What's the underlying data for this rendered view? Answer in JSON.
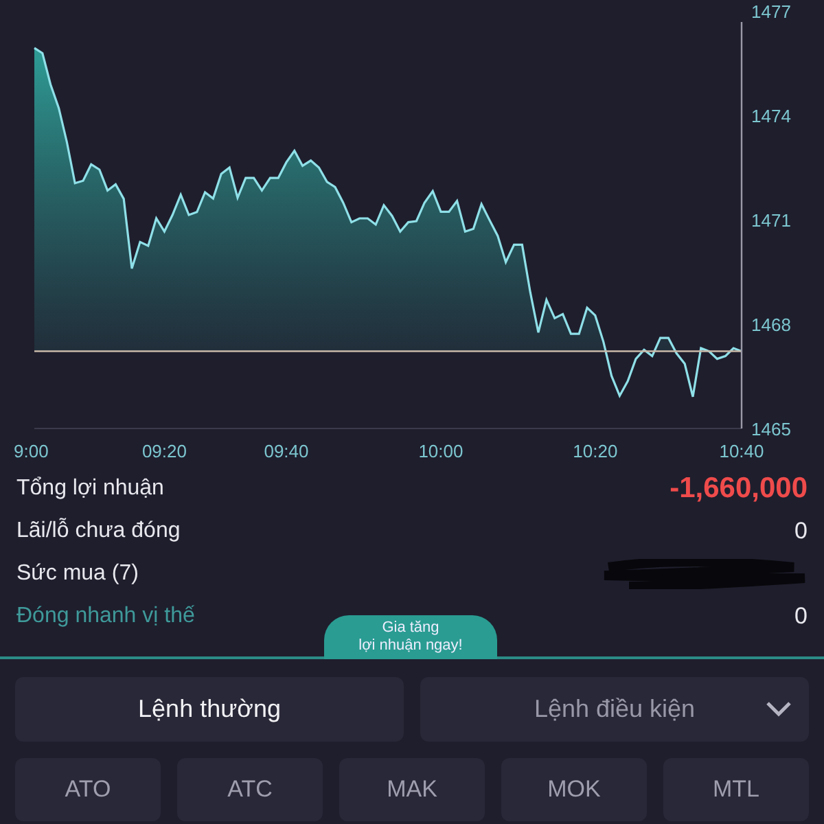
{
  "chart": {
    "chart_data": {
      "type": "area",
      "categories": [
        "9:00",
        null,
        null,
        null,
        null,
        null,
        null,
        null,
        null,
        null,
        null,
        null,
        null,
        null,
        null,
        null,
        "09:20",
        null,
        null,
        null,
        null,
        null,
        null,
        null,
        null,
        null,
        null,
        null,
        null,
        null,
        null,
        "09:40",
        null,
        null,
        null,
        null,
        null,
        null,
        null,
        null,
        null,
        null,
        null,
        null,
        null,
        null,
        null,
        null,
        null,
        null,
        "10:00",
        null,
        null,
        null,
        null,
        null,
        null,
        null,
        null,
        null,
        null,
        null,
        null,
        null,
        null,
        null,
        null,
        null,
        null,
        "10:20",
        null,
        null,
        null,
        null,
        null,
        null,
        null,
        null,
        null,
        null,
        null,
        null,
        null,
        null,
        null,
        null,
        null,
        "10:40"
      ],
      "series": [
        {
          "color": "#8fe0e8",
          "values": [
            1475.94,
            1475.79,
            1474.89,
            1474.21,
            1473.23,
            1472.05,
            1472.12,
            1472.59,
            1472.44,
            1471.84,
            1472.02,
            1471.6,
            1469.6,
            1470.36,
            1470.25,
            1471.04,
            1470.66,
            1471.14,
            1471.72,
            1471.14,
            1471.22,
            1471.79,
            1471.61,
            1472.32,
            1472.5,
            1471.63,
            1472.2,
            1472.2,
            1471.84,
            1472.2,
            1472.2,
            1472.65,
            1472.98,
            1472.55,
            1472.7,
            1472.5,
            1472.09,
            1471.94,
            1471.49,
            1470.93,
            1471.04,
            1471.04,
            1470.86,
            1471.42,
            1471.11,
            1470.66,
            1470.93,
            1470.96,
            1471.49,
            1471.82,
            1471.23,
            1471.23,
            1471.54,
            1470.66,
            1470.74,
            1471.45,
            1470.99,
            1470.54,
            1469.78,
            1470.28,
            1470.28,
            1468.92,
            1467.76,
            1468.7,
            1468.17,
            1468.29,
            1467.72,
            1467.72,
            1468.47,
            1468.25,
            1467.49,
            1466.51,
            1465.94,
            1466.36,
            1467.0,
            1467.26,
            1467.08,
            1467.6,
            1467.6,
            1467.16,
            1466.86,
            1465.91,
            1467.31,
            1467.22,
            1467.0,
            1467.08,
            1467.31,
            1467.22
          ]
        }
      ],
      "ylim": [
        1465,
        1477
      ],
      "yticks": [
        1465,
        1468,
        1471,
        1474,
        1477
      ],
      "ref_lines": [
        {
          "value": 1467.22,
          "axis": "y"
        }
      ]
    }
  },
  "summary": [
    {
      "label": "Tổng lợi nhuận",
      "value": "-1,660,000",
      "kind": "loss"
    },
    {
      "label": "Lãi/lỗ chưa đóng",
      "value": "0",
      "kind": "plain"
    },
    {
      "label": "Sức mua (7)",
      "kind": "hidden"
    },
    {
      "label": "Đóng nhanh vị thế",
      "value": "0",
      "kind": "action"
    }
  ],
  "promo": {
    "lines": [
      "Gia tăng",
      "lợi nhuận ngay!"
    ]
  },
  "order_tabs": [
    {
      "label": "Lệnh thường",
      "selected": true,
      "dropdown": false
    },
    {
      "label": "Lệnh điều kiện",
      "selected": false,
      "dropdown": true
    }
  ],
  "order_types": [
    "ATO",
    "ATC",
    "MAK",
    "MOK",
    "MTL"
  ]
}
